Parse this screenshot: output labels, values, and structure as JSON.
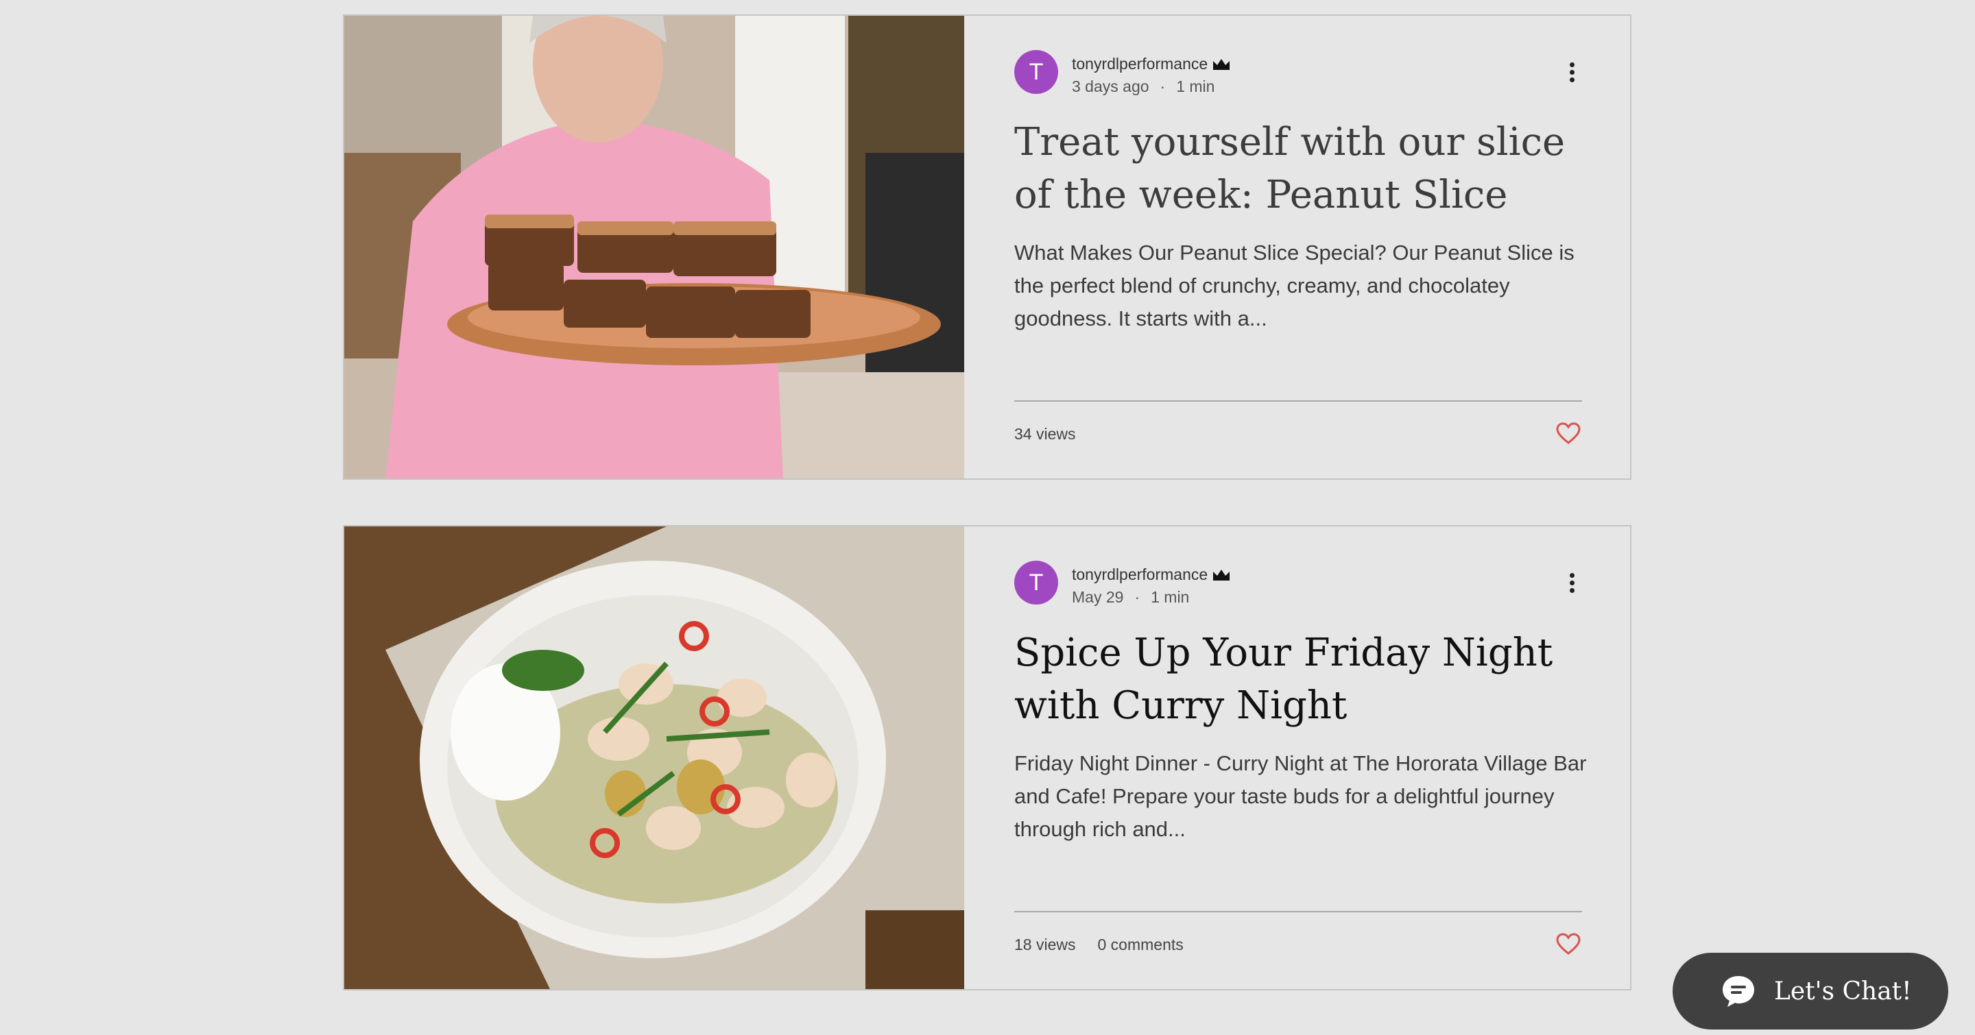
{
  "posts": [
    {
      "author": "tonyrdlperformance",
      "avatar_initial": "T",
      "date": "3 days ago",
      "read_time": "1 min",
      "title": "Treat yourself with our slice of the week: Peanut Slice",
      "excerpt": "What Makes Our Peanut Slice Special? Our Peanut Slice is the perfect blend of crunchy, creamy, and chocolatey goodness. It starts with a...",
      "views": "34 views",
      "comments": ""
    },
    {
      "author": "tonyrdlperformance",
      "avatar_initial": "T",
      "date": "May 29",
      "read_time": "1 min",
      "title": "Spice Up Your Friday Night with Curry Night",
      "excerpt": "Friday Night Dinner - Curry Night at The Hororata Village Bar and Cafe! Prepare your taste buds for a delightful journey through rich and...",
      "views": "18 views",
      "comments": "0 comments"
    }
  ],
  "chat": {
    "label": "Let's Chat!"
  },
  "colors": {
    "avatar": "#a048c2",
    "heart": "#d9534f",
    "chat_bg": "#404040"
  },
  "icons": [
    "crown-icon",
    "more-options-icon",
    "heart-icon",
    "chat-bubble-icon"
  ]
}
